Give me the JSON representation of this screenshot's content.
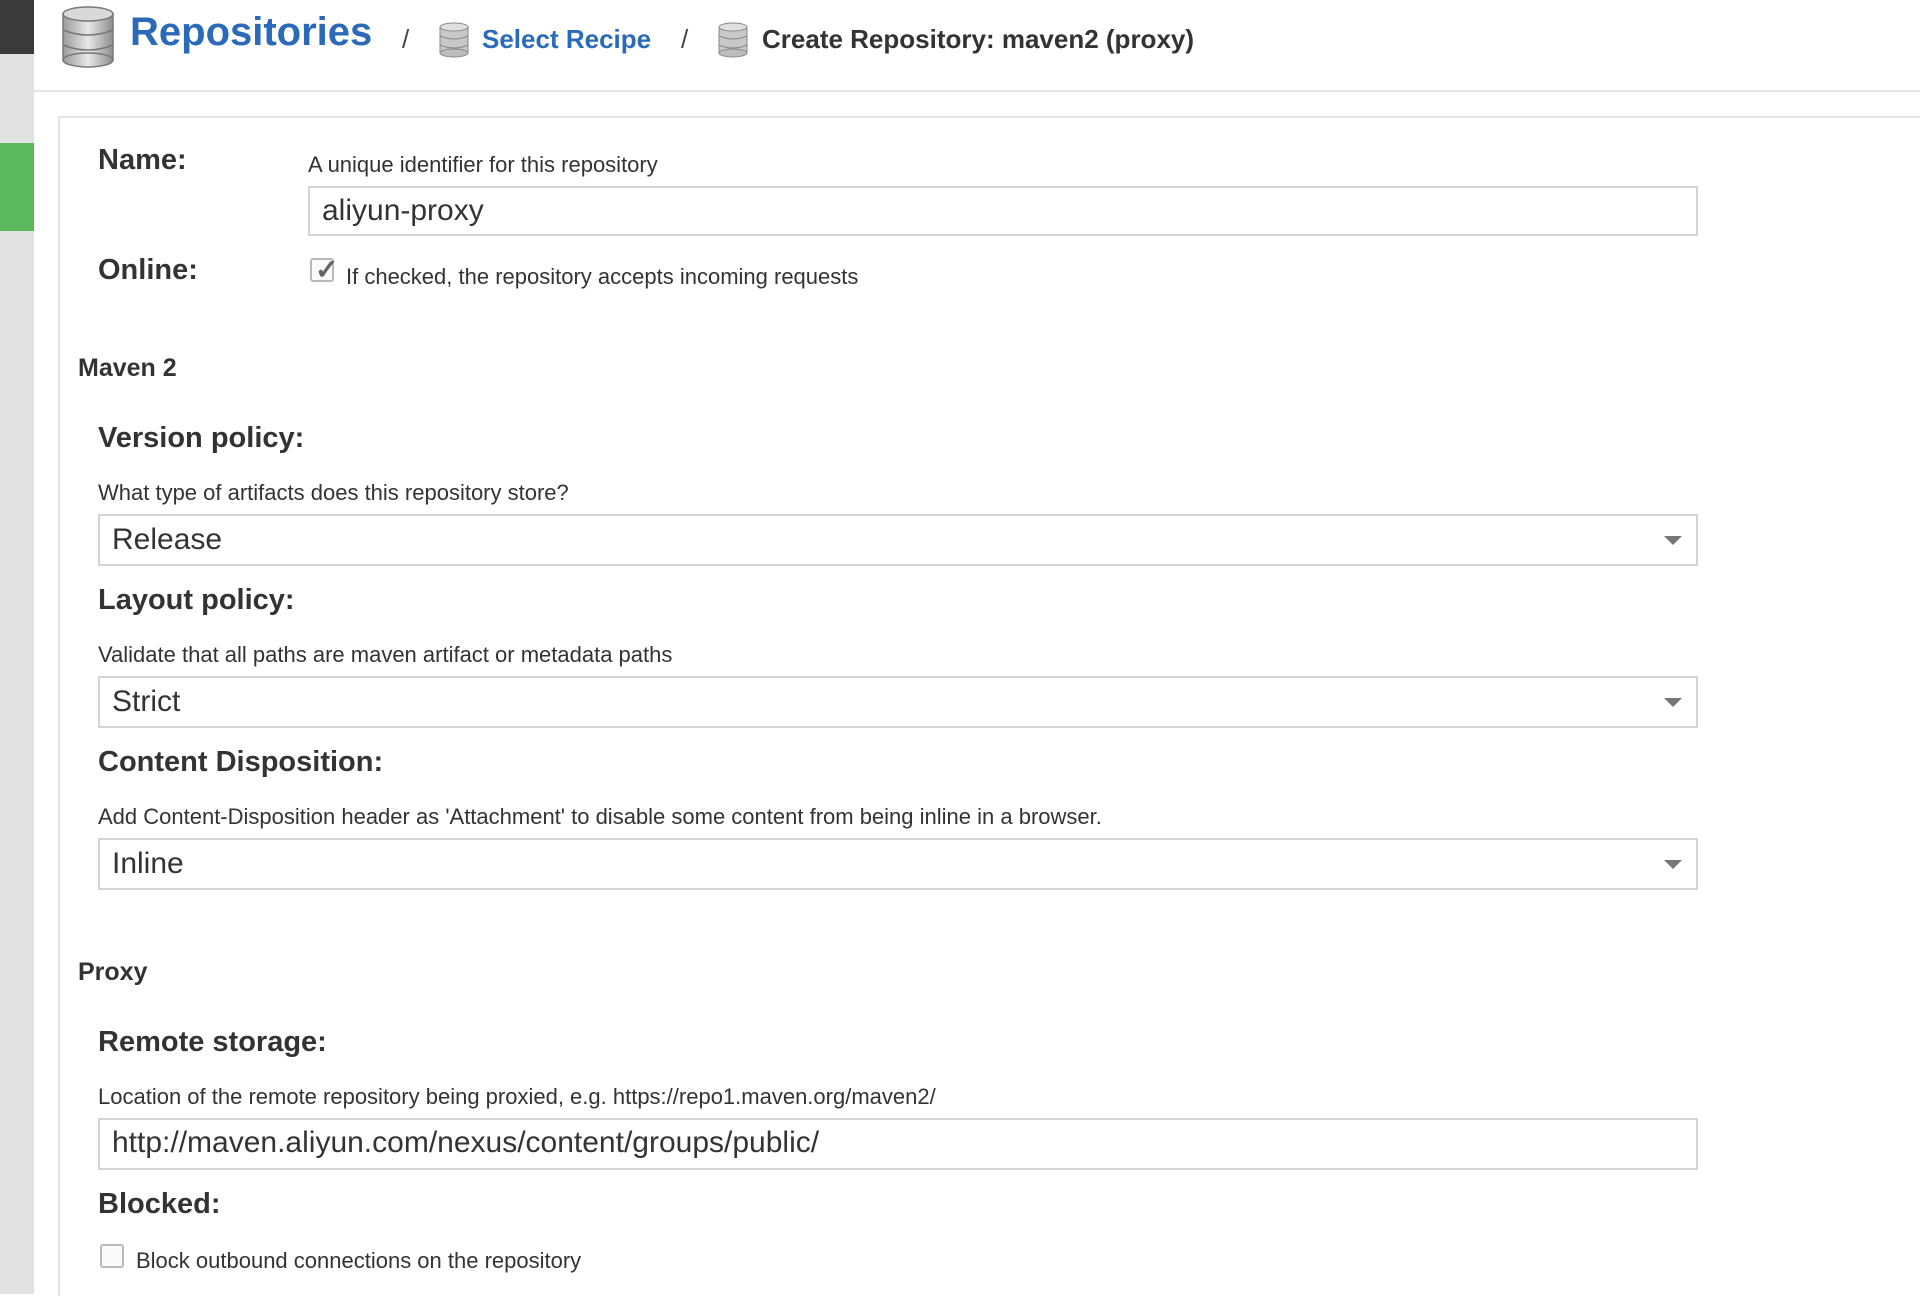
{
  "breadcrumb": {
    "root": "Repositories",
    "separator": "/",
    "step1": "Select Recipe",
    "current": "Create Repository: maven2 (proxy)"
  },
  "icons": [
    "database-icon",
    "checkmark-icon",
    "chevron-down-icon"
  ],
  "colors": {
    "link": "#2a6ab8",
    "nav_active": "#5cb85c"
  },
  "form": {
    "name": {
      "label": "Name:",
      "help": "A unique identifier for this repository",
      "value": "aliyun-proxy"
    },
    "online": {
      "label": "Online:",
      "help": "If checked, the repository accepts incoming requests",
      "checked": true
    },
    "maven2": {
      "section": "Maven 2",
      "version_policy": {
        "label": "Version policy:",
        "help": "What type of artifacts does this repository store?",
        "value": "Release"
      },
      "layout_policy": {
        "label": "Layout policy:",
        "help": "Validate that all paths are maven artifact or metadata paths",
        "value": "Strict"
      },
      "content_disposition": {
        "label": "Content Disposition:",
        "help": "Add Content-Disposition header as 'Attachment' to disable some content from being inline in a browser.",
        "value": "Inline"
      }
    },
    "proxy": {
      "section": "Proxy",
      "remote_storage": {
        "label": "Remote storage:",
        "help": "Location of the remote repository being proxied, e.g. https://repo1.maven.org/maven2/",
        "value": "http://maven.aliyun.com/nexus/content/groups/public/"
      },
      "blocked": {
        "label": "Blocked:",
        "help": "Block outbound connections on the repository",
        "checked": false
      }
    }
  }
}
